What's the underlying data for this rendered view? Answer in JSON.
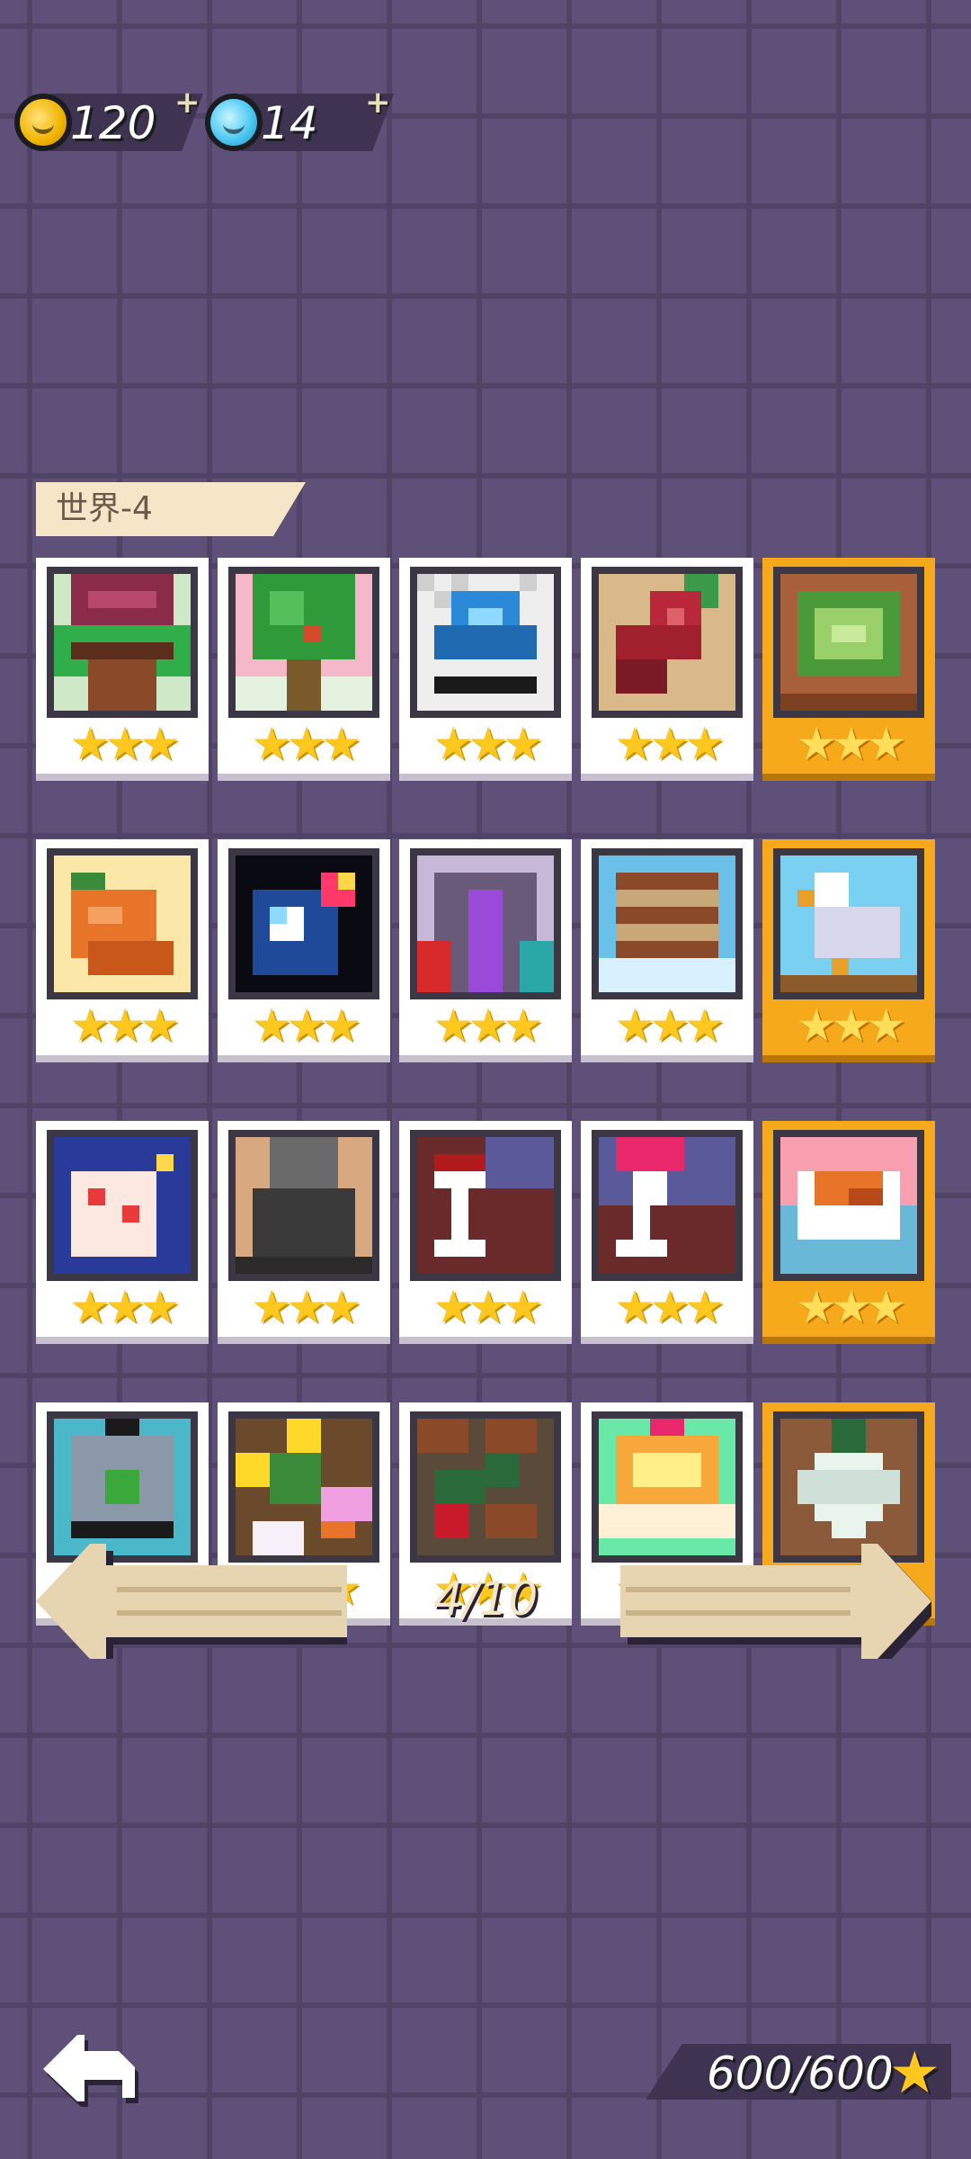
{
  "currency": {
    "coins": "120",
    "gems": "14",
    "add_symbol": "+"
  },
  "world": {
    "title": "世界-4"
  },
  "levels": [
    {
      "art": "flower-pot",
      "stars": 3,
      "gold": false
    },
    {
      "art": "tree",
      "stars": 3,
      "gold": false
    },
    {
      "art": "blue-gem",
      "stars": 3,
      "gold": false
    },
    {
      "art": "meat",
      "stars": 3,
      "gold": false
    },
    {
      "art": "cabbage",
      "stars": 3,
      "gold": true
    },
    {
      "art": "roast-chicken",
      "stars": 3,
      "gold": false
    },
    {
      "art": "blue-bomb",
      "stars": 3,
      "gold": false
    },
    {
      "art": "portal",
      "stars": 3,
      "gold": false
    },
    {
      "art": "barrel",
      "stars": 3,
      "gold": false
    },
    {
      "art": "seagull",
      "stars": 3,
      "gold": true
    },
    {
      "art": "card-heart",
      "stars": 3,
      "gold": false
    },
    {
      "art": "dark-statue",
      "stars": 3,
      "gold": false
    },
    {
      "art": "wine-glass",
      "stars": 3,
      "gold": false
    },
    {
      "art": "cocktail",
      "stars": 3,
      "gold": false
    },
    {
      "art": "meat-plate",
      "stars": 3,
      "gold": true
    },
    {
      "art": "backpack",
      "stars": 3,
      "gold": false
    },
    {
      "art": "flowers",
      "stars": 3,
      "gold": false
    },
    {
      "art": "vines",
      "stars": 3,
      "gold": false
    },
    {
      "art": "cake",
      "stars": 3,
      "gold": false
    },
    {
      "art": "turnip",
      "stars": 3,
      "gold": true
    }
  ],
  "pager": {
    "text": "4/10"
  },
  "total_stars": {
    "text": "600/600"
  },
  "colors": {
    "background": "#5e5078",
    "card_gold": "#f7a91c",
    "star": "#ffc81e",
    "banner": "#f5e6c8"
  }
}
